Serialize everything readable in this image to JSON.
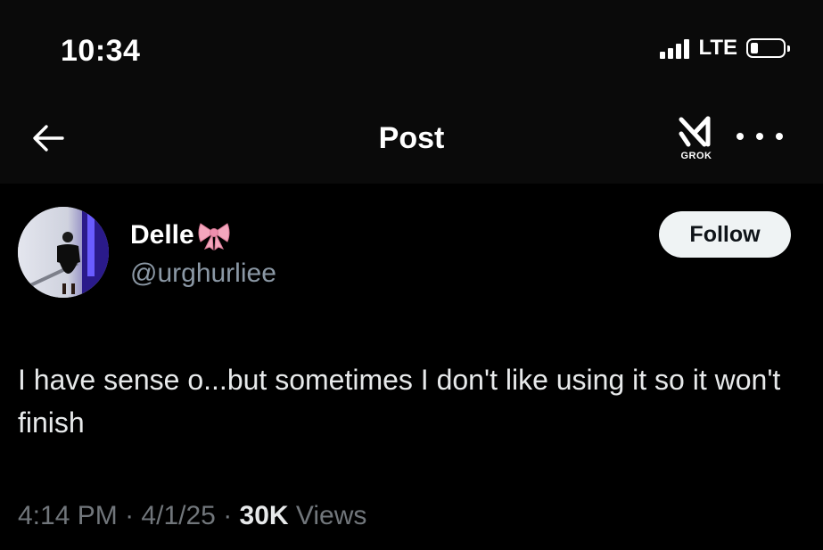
{
  "status_bar": {
    "time": "10:34",
    "network": "LTE",
    "icons": [
      "signal-bars-icon",
      "battery-icon"
    ]
  },
  "nav": {
    "title": "Post",
    "back_icon": "arrow-left-icon",
    "grok_label": "GROK",
    "more_icon": "more-dots-icon"
  },
  "post": {
    "author": {
      "display_name": "Delle",
      "handle": "@urghurliee",
      "name_emoji": "pink-bow-icon"
    },
    "follow_label": "Follow",
    "text": "I have sense o...but sometimes I don't like using it so it won't finish",
    "time": "4:14 PM",
    "date": "4/1/25",
    "separator": "·",
    "views_count": "30K",
    "views_label": "Views"
  },
  "colors": {
    "background": "#000000",
    "header_background": "#0a0a0a",
    "text_primary": "#e7e9ea",
    "text_secondary": "#71767b",
    "follow_button_bg": "#eff3f4",
    "bow_pink": "#f4a6bd"
  }
}
